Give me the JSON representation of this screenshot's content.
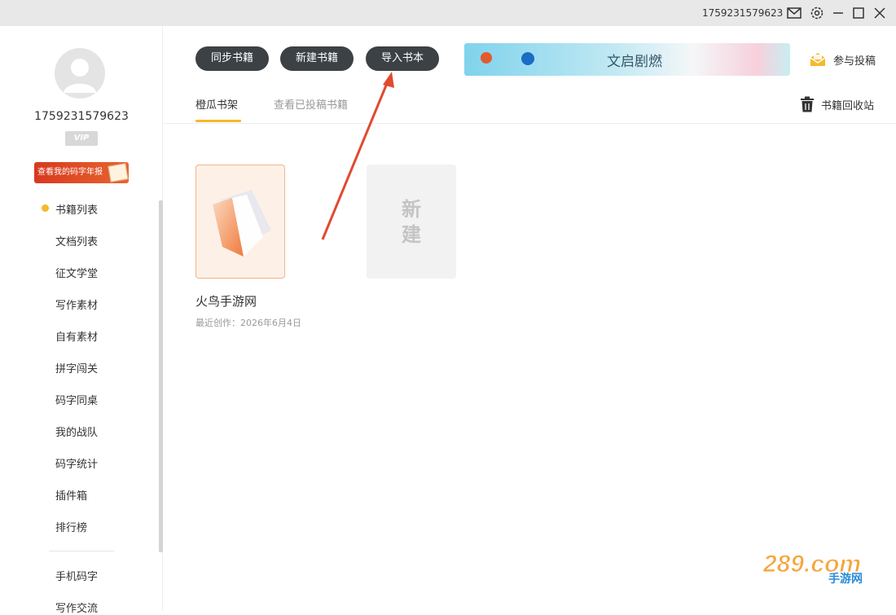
{
  "titlebar": {
    "user_id": "1759231579623"
  },
  "sidebar": {
    "username": "1759231579623",
    "vip_label": "VIP",
    "report_label": "查看我的码字年报",
    "items": [
      {
        "label": "书籍列表",
        "active": true
      },
      {
        "label": "文档列表"
      },
      {
        "label": "征文学堂"
      },
      {
        "label": "写作素材"
      },
      {
        "label": "自有素材"
      },
      {
        "label": "拼字闯关"
      },
      {
        "label": "码字同桌"
      },
      {
        "label": "我的战队"
      },
      {
        "label": "码字统计"
      },
      {
        "label": "插件箱"
      },
      {
        "label": "排行榜"
      }
    ],
    "bottom_items": [
      {
        "label": "手机码字"
      },
      {
        "label": "写作交流"
      }
    ]
  },
  "toolbar": {
    "sync_label": "同步书籍",
    "new_label": "新建书籍",
    "import_label": "导入书本",
    "submit_label": "参与投稿"
  },
  "banner": {
    "text": "文启剧燃"
  },
  "tabs": [
    {
      "label": "橙瓜书架",
      "active": true
    },
    {
      "label": "查看已投稿书籍",
      "active": false
    }
  ],
  "recycle_label": "书籍回收站",
  "books": [
    {
      "title": "火鸟手游网",
      "date": "最近创作：2026年6月4日"
    }
  ],
  "new_card_label": "新建",
  "watermark": {
    "text": "289.com",
    "sub": "手游网"
  },
  "colors": {
    "accent": "#f5b92b",
    "button_bg": "#3c4145",
    "arrow": "#e04a2f"
  }
}
